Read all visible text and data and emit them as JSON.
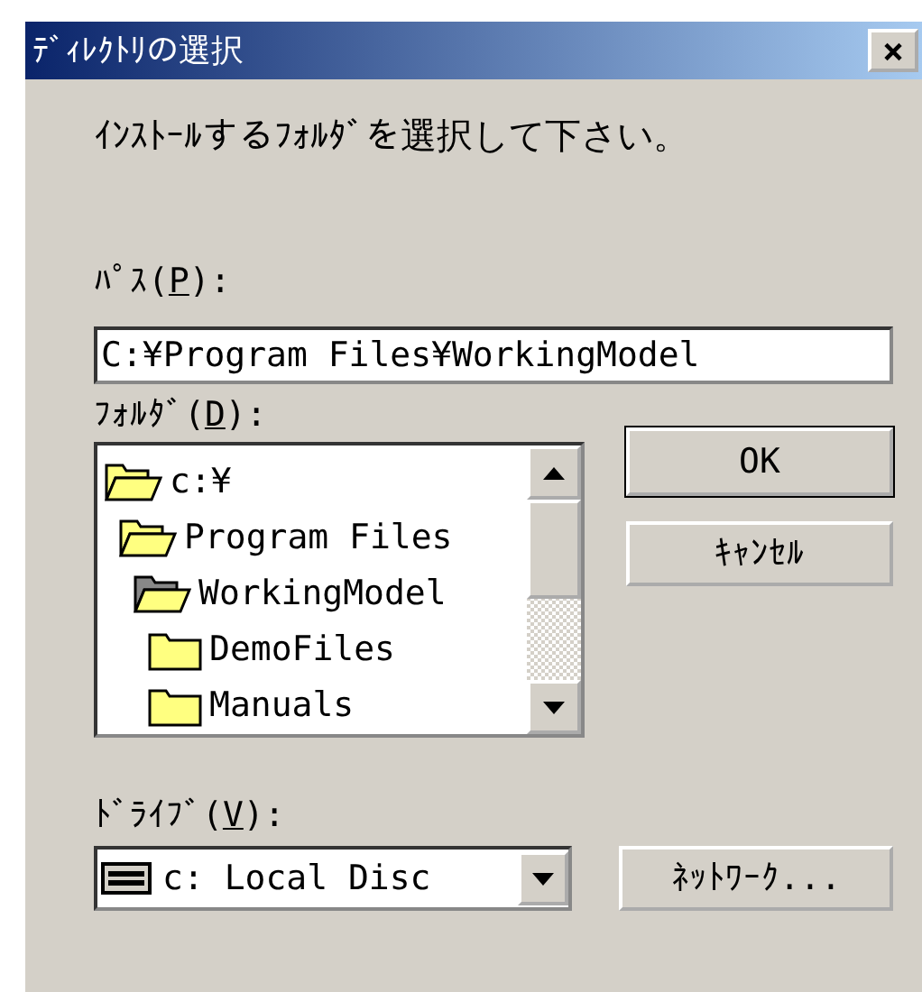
{
  "window": {
    "title": "ﾃﾞｨﾚｸﾄﾘの選択",
    "close": "×"
  },
  "instruction": "ｲﾝｽﾄｰﾙするﾌｫﾙﾀﾞを選択して下さい。",
  "path": {
    "label": "ﾊﾟｽ(",
    "access_key": "P",
    "label_end": "):",
    "value": "C:¥Program Files¥WorkingModel"
  },
  "folders": {
    "label": "ﾌｫﾙﾀﾞ(",
    "access_key": "D",
    "label_end": "):",
    "tree": [
      {
        "name": "c:¥",
        "expanded": true,
        "selected": false,
        "children": [
          {
            "name": "Program Files",
            "expanded": true,
            "selected": false,
            "children": [
              {
                "name": "WorkingModel",
                "expanded": true,
                "selected": true,
                "children": [
                  {
                    "name": "DemoFiles",
                    "expanded": false,
                    "selected": false
                  },
                  {
                    "name": "Manuals",
                    "expanded": false,
                    "selected": false
                  }
                ]
              }
            ]
          }
        ]
      }
    ]
  },
  "drive": {
    "label": "ﾄﾞﾗｲﾌﾞ(",
    "access_key": "V",
    "label_end": "):",
    "value": "c: Local Disc"
  },
  "buttons": [
    {
      "label": "OK",
      "default": true
    },
    {
      "label": "ｷｬﾝｾﾙ",
      "default": false
    }
  ],
  "network_button": {
    "label": "ﾈｯﾄﾜｰｸ..."
  }
}
